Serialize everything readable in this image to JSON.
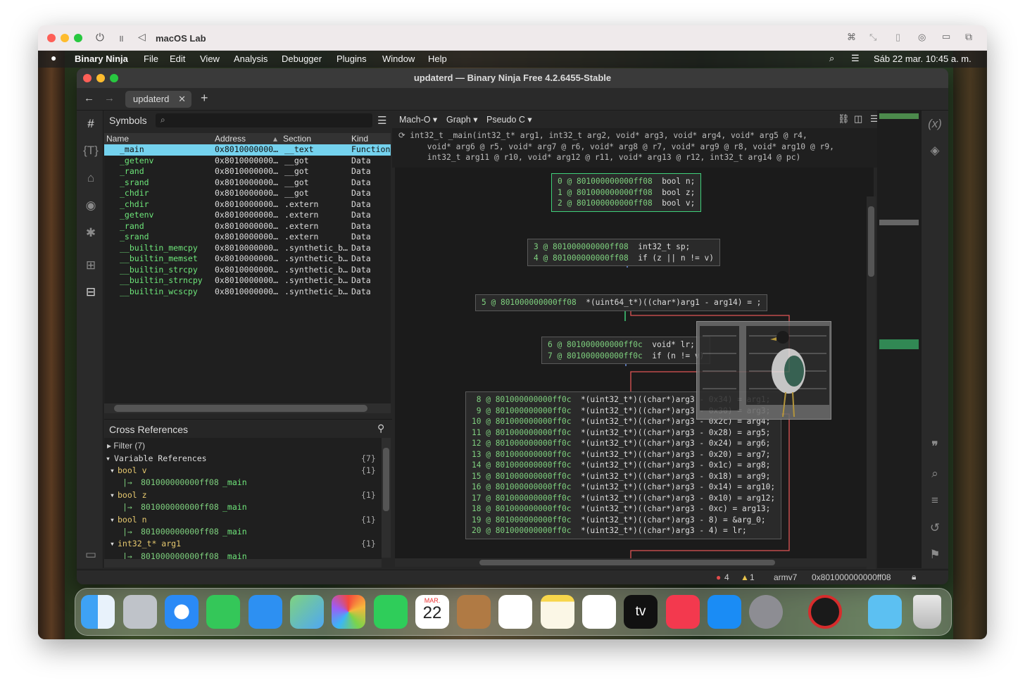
{
  "vm": {
    "title": "macOS Lab"
  },
  "menubar": {
    "apple": "",
    "items": [
      "Binary Ninja",
      "File",
      "Edit",
      "View",
      "Analysis",
      "Debugger",
      "Plugins",
      "Window",
      "Help"
    ],
    "clock": "Sáb 22 mar.  10:45 a. m."
  },
  "window": {
    "title": "updaterd — Binary Ninja Free 4.2.6455-Stable",
    "tab": "updaterd"
  },
  "symbols": {
    "title": "Symbols",
    "columns": [
      "Name",
      "Address",
      "Section",
      "Kind"
    ],
    "rows": [
      [
        "_main",
        "0x8010000000…",
        "__text",
        "Function"
      ],
      [
        "_getenv",
        "0x8010000000…",
        "__got",
        "Data"
      ],
      [
        "_rand",
        "0x8010000000…",
        "__got",
        "Data"
      ],
      [
        "_srand",
        "0x8010000000…",
        "__got",
        "Data"
      ],
      [
        "_chdir",
        "0x8010000000…",
        "__got",
        "Data"
      ],
      [
        "_chdir",
        "0x8010000000…",
        ".extern",
        "Data"
      ],
      [
        "_getenv",
        "0x8010000000…",
        ".extern",
        "Data"
      ],
      [
        "_rand",
        "0x8010000000…",
        ".extern",
        "Data"
      ],
      [
        "_srand",
        "0x8010000000…",
        ".extern",
        "Data"
      ],
      [
        "__builtin_memcpy",
        "0x8010000000…",
        ".synthetic_b…",
        "Data"
      ],
      [
        "__builtin_memset",
        "0x8010000000…",
        ".synthetic_b…",
        "Data"
      ],
      [
        "__builtin_strcpy",
        "0x8010000000…",
        ".synthetic_b…",
        "Data"
      ],
      [
        "__builtin_strncpy",
        "0x8010000000…",
        ".synthetic_b…",
        "Data"
      ],
      [
        "__builtin_wcscpy",
        "0x8010000000…",
        ".synthetic_b…",
        "Data"
      ]
    ]
  },
  "xrefs": {
    "title": "Cross References",
    "filter": "Filter (7)",
    "group": "Variable References",
    "group_count": "{7}",
    "items": [
      {
        "var": "bool v",
        "count": "{1}",
        "ref": "801000000000ff08",
        "fn": "_main"
      },
      {
        "var": "bool z",
        "count": "{1}",
        "ref": "801000000000ff08",
        "fn": "_main"
      },
      {
        "var": "bool n",
        "count": "{1}",
        "ref": "801000000000ff08",
        "fn": "_main"
      },
      {
        "var": "int32_t* arg1",
        "count": "{1}",
        "ref": "801000000000ff08",
        "fn": "_main"
      }
    ]
  },
  "view": {
    "menus": [
      "Mach-O",
      "Graph",
      "Pseudo C"
    ],
    "signature": [
      "int32_t _main(int32_t* arg1, int32_t arg2, void* arg3, void* arg4, void* arg5 @ r4,",
      "    void* arg6 @ r5, void* arg7 @ r6, void* arg8 @ r7, void* arg9 @ r8, void* arg10 @ r9,",
      "    int32_t arg11 @ r10, void* arg12 @ r11, void* arg13 @ r12, int32_t arg14 @ pc)"
    ]
  },
  "blocks": [
    {
      "lines": [
        [
          "0",
          "801000000000ff08",
          "bool n;"
        ],
        [
          "1",
          "801000000000ff08",
          "bool z;"
        ],
        [
          "2",
          "801000000000ff08",
          "bool v;"
        ]
      ]
    },
    {
      "lines": [
        [
          "3",
          "801000000000ff08",
          "int32_t sp;"
        ],
        [
          "4",
          "801000000000ff08",
          "if (z || n != v)"
        ]
      ]
    },
    {
      "lines": [
        [
          "5",
          "801000000000ff08",
          "*(uint64_t*)((char*)arg1 - arg14) = ;"
        ]
      ]
    },
    {
      "lines": [
        [
          "6",
          "801000000000ff0c",
          "void* lr;"
        ],
        [
          "7",
          "801000000000ff0c",
          "if (n != v)"
        ]
      ]
    },
    {
      "lines": [
        [
          "8",
          "801000000000ff0c",
          "*(uint32_t*)((char*)arg3 - 0x34) = arg1;"
        ],
        [
          "9",
          "801000000000ff0c",
          "*(uint32_t*)((char*)arg3 - 0x30) = arg3;"
        ],
        [
          "10",
          "801000000000ff0c",
          "*(uint32_t*)((char*)arg3 - 0x2c) = arg4;"
        ],
        [
          "11",
          "801000000000ff0c",
          "*(uint32_t*)((char*)arg3 - 0x28) = arg5;"
        ],
        [
          "12",
          "801000000000ff0c",
          "*(uint32_t*)((char*)arg3 - 0x24) = arg6;"
        ],
        [
          "13",
          "801000000000ff0c",
          "*(uint32_t*)((char*)arg3 - 0x20) = arg7;"
        ],
        [
          "14",
          "801000000000ff0c",
          "*(uint32_t*)((char*)arg3 - 0x1c) = arg8;"
        ],
        [
          "15",
          "801000000000ff0c",
          "*(uint32_t*)((char*)arg3 - 0x18) = arg9;"
        ],
        [
          "16",
          "801000000000ff0c",
          "*(uint32_t*)((char*)arg3 - 0x14) = arg10;"
        ],
        [
          "17",
          "801000000000ff0c",
          "*(uint32_t*)((char*)arg3 - 0x10) = arg12;"
        ],
        [
          "18",
          "801000000000ff0c",
          "*(uint32_t*)((char*)arg3 - 0xc) = arg13;"
        ],
        [
          "19",
          "801000000000ff0c",
          "*(uint32_t*)((char*)arg3 - 8) = &arg_0;"
        ],
        [
          "20",
          "801000000000ff0c",
          "*(uint32_t*)((char*)arg3 - 4) = lr;"
        ]
      ]
    }
  ],
  "status": {
    "errors": "4",
    "warnings": "1",
    "arch": "armv7",
    "address": "0x801000000000ff08"
  },
  "dock": {
    "calendar_month": "MAR.",
    "calendar_day": "22",
    "tv_label": "tv"
  },
  "colors": {
    "selection": "#74d2ee",
    "symbol_name": "#6ee67a",
    "edge_true": "#3fd07a",
    "edge_false": "#e05555",
    "edge_uncond": "#6a8fe0"
  }
}
